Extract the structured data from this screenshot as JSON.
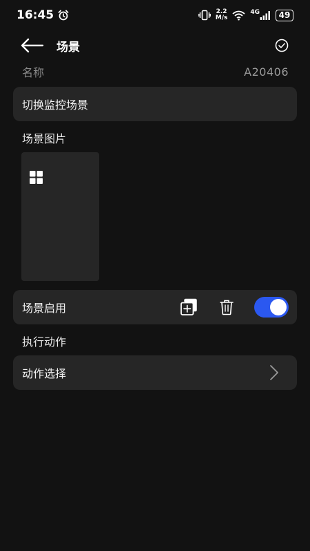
{
  "status_bar": {
    "time": "16:45",
    "net_speed_value": "2.2",
    "net_speed_unit": "M/s",
    "network_type": "4G",
    "battery": "49"
  },
  "header": {
    "title": "场景"
  },
  "name_row": {
    "label": "名称",
    "value": "A20406"
  },
  "scene_name_card": {
    "text": "切换监控场景"
  },
  "scene_image_section": {
    "label": "场景图片"
  },
  "scene_enable": {
    "label": "场景启用",
    "enabled": true
  },
  "action_section": {
    "label": "执行动作"
  },
  "action_select": {
    "label": "动作选择"
  },
  "colors": {
    "background": "#121212",
    "card": "#262626",
    "toggle_on": "#2b58f0",
    "muted_text": "#8a8a8a"
  },
  "icons": [
    "alarm-icon",
    "vibrate-icon",
    "wifi-icon",
    "signal-icon",
    "back-arrow-icon",
    "check-circle-icon",
    "grid-icon",
    "copy-add-icon",
    "trash-icon",
    "chevron-right-icon"
  ]
}
